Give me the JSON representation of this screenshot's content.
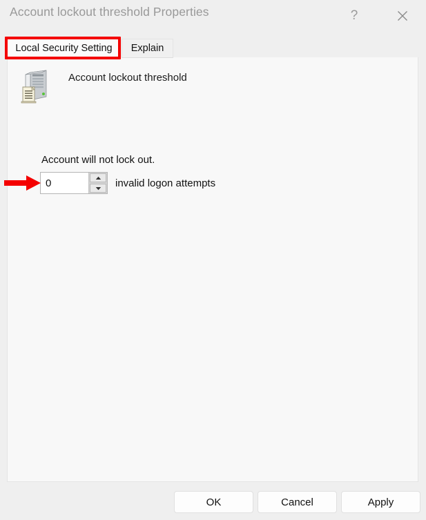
{
  "window": {
    "title": "Account lockout threshold Properties",
    "help_icon": "question-mark-icon",
    "close_icon": "close-x-icon"
  },
  "tabs": [
    {
      "id": "local-security-setting",
      "label": "Local Security Setting",
      "active": true
    },
    {
      "id": "explain",
      "label": "Explain",
      "active": false
    }
  ],
  "content": {
    "policy_icon": "server-policy-icon",
    "policy_name": "Account lockout threshold",
    "lockout_status": "Account will not lock out.",
    "threshold": {
      "value": "0",
      "placeholder": "0",
      "unit_label": "invalid logon attempts",
      "increment_icon": "spinner-up-arrow-icon",
      "decrement_icon": "spinner-down-arrow-icon"
    }
  },
  "footer": {
    "ok_label": "OK",
    "cancel_label": "Cancel",
    "apply_label": "Apply"
  },
  "annotations": {
    "color": "#f40000",
    "tab_highlight_target": "Local Security Setting",
    "arrow_target": "threshold value field"
  }
}
